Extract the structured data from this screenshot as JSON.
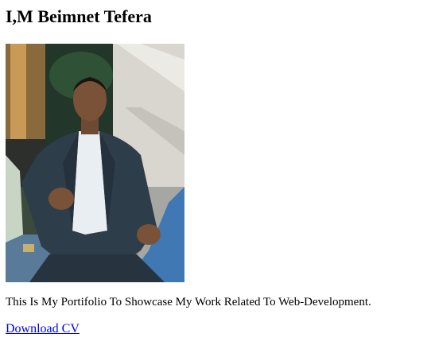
{
  "header": {
    "title": "I,M Beimnet Tefera"
  },
  "profile": {
    "photo_icon": "portrait-photo",
    "intro": "This Is My Portifolio To Showcase My Work Related To Web-Development.",
    "cv_link_label": "Download CV",
    "link_color": "#0000ee"
  }
}
